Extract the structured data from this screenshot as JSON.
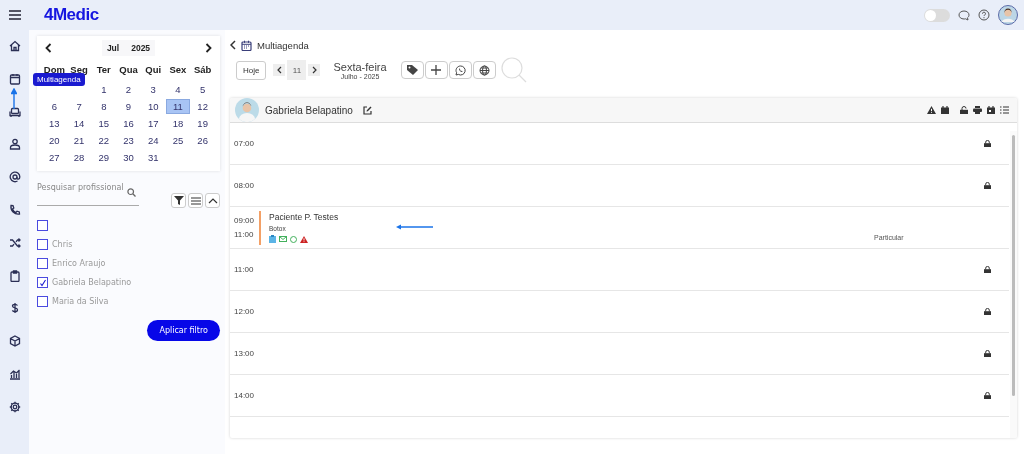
{
  "app": {
    "logo": "4Medic"
  },
  "topbar": {
    "toggle_on": false
  },
  "tooltip": {
    "text": "Multiagenda"
  },
  "calendar": {
    "month": "Jul",
    "year": "2025",
    "weekdays": [
      "Dom",
      "Seg",
      "Ter",
      "Qua",
      "Qui",
      "Sex",
      "Sáb"
    ],
    "weeks": [
      [
        {
          "kind": "empty"
        },
        {
          "kind": "empty"
        },
        {
          "day": "1",
          "selected": false
        },
        {
          "day": "2",
          "selected": false
        },
        {
          "day": "3",
          "selected": false
        },
        {
          "day": "4",
          "selected": false
        },
        {
          "day": "5",
          "selected": false
        }
      ],
      [
        {
          "day": "6",
          "selected": false
        },
        {
          "day": "7",
          "selected": false
        },
        {
          "day": "8",
          "selected": false
        },
        {
          "day": "9",
          "selected": false
        },
        {
          "day": "10",
          "selected": false
        },
        {
          "day": "11",
          "selected": true
        },
        {
          "day": "12",
          "selected": false
        }
      ],
      [
        {
          "day": "13",
          "selected": false
        },
        {
          "day": "14",
          "selected": false
        },
        {
          "day": "15",
          "selected": false
        },
        {
          "day": "16",
          "selected": false
        },
        {
          "day": "17",
          "selected": false
        },
        {
          "day": "18",
          "selected": false
        },
        {
          "day": "19",
          "selected": false
        }
      ],
      [
        {
          "day": "20",
          "selected": false
        },
        {
          "day": "21",
          "selected": false
        },
        {
          "day": "22",
          "selected": false
        },
        {
          "day": "23",
          "selected": false
        },
        {
          "day": "24",
          "selected": false
        },
        {
          "day": "25",
          "selected": false
        },
        {
          "day": "26",
          "selected": false
        }
      ],
      [
        {
          "day": "27",
          "selected": false
        },
        {
          "day": "28",
          "selected": false
        },
        {
          "day": "29",
          "selected": false
        },
        {
          "day": "30",
          "selected": false
        },
        {
          "day": "31",
          "selected": false
        },
        {
          "kind": "empty"
        },
        {
          "kind": "empty"
        }
      ]
    ]
  },
  "search": {
    "placeholder": "Pesquisar profissional"
  },
  "professionals": [
    {
      "checked": false
    },
    {
      "name": "Chris",
      "checked": false
    },
    {
      "name": "Enrico Araujo",
      "checked": false
    },
    {
      "name": "Gabriela Belapatino",
      "checked": true
    },
    {
      "name": "Maria da Silva",
      "checked": false
    }
  ],
  "apply_button": "Aplicar filtro",
  "page": {
    "title": "Multiagenda"
  },
  "toolbar": {
    "today": "Hoje",
    "day": "11",
    "weekday": "Sexta-feira",
    "month": "Julho - 2025"
  },
  "agenda": {
    "professional": "Gabriela Belapatino",
    "slots": [
      {
        "kind": "free",
        "time": "07:00",
        "locked": true
      },
      {
        "kind": "free",
        "time": "08:00",
        "locked": true
      },
      {
        "kind": "appointment",
        "start": "09:00",
        "end": "11:00",
        "patient": "Paciente P. Testes",
        "procedure": "Botox",
        "payer": "Particular"
      },
      {
        "kind": "free",
        "time": "11:00",
        "locked": true
      },
      {
        "kind": "free",
        "time": "12:00",
        "locked": true
      },
      {
        "kind": "free",
        "time": "13:00",
        "locked": true
      },
      {
        "kind": "free",
        "time": "14:00",
        "locked": true
      }
    ]
  }
}
